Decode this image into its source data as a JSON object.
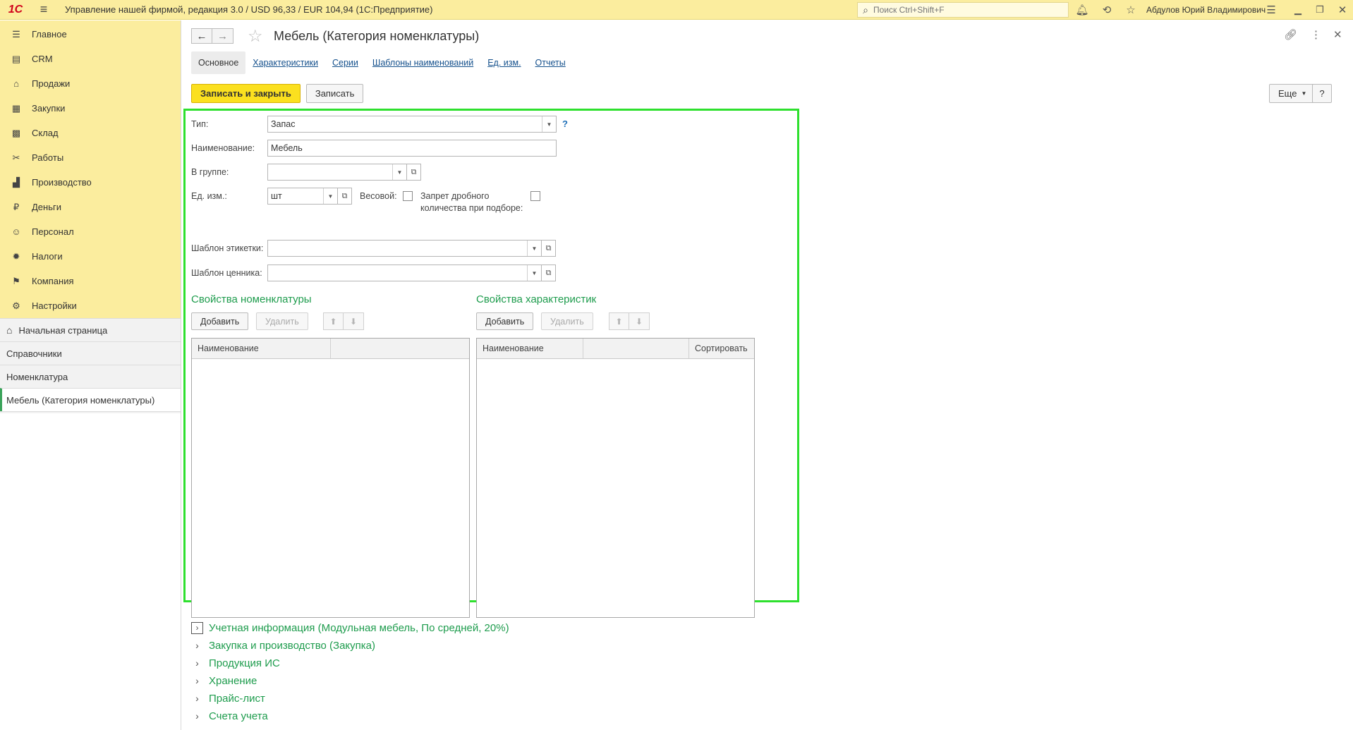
{
  "topbar": {
    "logo": "1С",
    "title": "Управление нашей фирмой, редакция 3.0 / USD 96,33 / EUR 104,94  (1С:Предприятие)",
    "search_placeholder": "Поиск Ctrl+Shift+F",
    "user": "Абдулов Юрий Владимирович"
  },
  "sidebar": {
    "sections": [
      {
        "label": "Главное",
        "icon": "☰"
      },
      {
        "label": "CRM",
        "icon": "▤"
      },
      {
        "label": "Продажи",
        "icon": "⌂"
      },
      {
        "label": "Закупки",
        "icon": "▦"
      },
      {
        "label": "Склад",
        "icon": "▩"
      },
      {
        "label": "Работы",
        "icon": "✂"
      },
      {
        "label": "Производство",
        "icon": "▟"
      },
      {
        "label": "Деньги",
        "icon": "₽"
      },
      {
        "label": "Персонал",
        "icon": "☺"
      },
      {
        "label": "Налоги",
        "icon": "✹"
      },
      {
        "label": "Компания",
        "icon": "⚑"
      },
      {
        "label": "Настройки",
        "icon": "⚙"
      }
    ],
    "open_windows": [
      {
        "label": "Начальная страница"
      },
      {
        "label": "Справочники"
      },
      {
        "label": "Номенклатура"
      },
      {
        "label": "Мебель (Категория номенклатуры)"
      }
    ]
  },
  "form": {
    "title": "Мебель (Категория номенклатуры)",
    "tabs": [
      "Основное",
      "Характеристики",
      "Серии",
      "Шаблоны наименований",
      "Ед. изм.",
      "Отчеты"
    ],
    "save_close_label": "Записать и закрыть",
    "save_label": "Записать",
    "more_label": "Еще",
    "help_label": "?",
    "fields": {
      "type_label": "Тип:",
      "type_value": "Запас",
      "type_help": "?",
      "name_label": "Наименование:",
      "name_value": "Мебель",
      "group_label": "В группе:",
      "group_value": "",
      "unit_label": "Ед. изм.:",
      "unit_value": "шт",
      "weight_label": "Весовой:",
      "fraction_label_1": "Запрет дробного",
      "fraction_label_2": "количества при подборе:",
      "label_template_label": "Шаблон этикетки:",
      "label_template_value": "",
      "price_template_label": "Шаблон ценника:",
      "price_template_value": ""
    },
    "nomenclature_props": {
      "title": "Свойства номенклатуры",
      "add_label": "Добавить",
      "delete_label": "Удалить",
      "columns": [
        "Наименование",
        ""
      ]
    },
    "characteristic_props": {
      "title": "Свойства характеристик",
      "add_label": "Добавить",
      "delete_label": "Удалить",
      "columns": [
        "Наименование",
        "",
        "Сортировать"
      ]
    },
    "collapsibles": [
      "Учетная информация (Модульная мебель, По средней, 20%)",
      "Закупка и производство (Закупка)",
      "Продукция ИС",
      "Хранение",
      "Прайс-лист",
      "Счета учета"
    ]
  }
}
